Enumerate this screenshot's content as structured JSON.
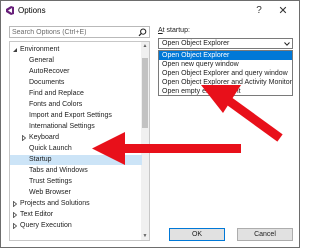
{
  "window": {
    "title": "Options",
    "help_symbol": "?",
    "close_symbol": "✕"
  },
  "search": {
    "placeholder": "Search Options (Ctrl+E)"
  },
  "tree": [
    {
      "label": "Environment",
      "indent": 0,
      "expander": "expanded"
    },
    {
      "label": "General",
      "indent": 1
    },
    {
      "label": "AutoRecover",
      "indent": 1
    },
    {
      "label": "Documents",
      "indent": 1
    },
    {
      "label": "Find and Replace",
      "indent": 1
    },
    {
      "label": "Fonts and Colors",
      "indent": 1
    },
    {
      "label": "Import and Export Settings",
      "indent": 1
    },
    {
      "label": "International Settings",
      "indent": 1
    },
    {
      "label": "Keyboard",
      "indent": 1,
      "expander": "collapsed"
    },
    {
      "label": "Quick Launch",
      "indent": 1
    },
    {
      "label": "Startup",
      "indent": 1,
      "selected": true
    },
    {
      "label": "Tabs and Windows",
      "indent": 1
    },
    {
      "label": "Trust Settings",
      "indent": 1
    },
    {
      "label": "Web Browser",
      "indent": 1
    },
    {
      "label": "Projects and Solutions",
      "indent": 0,
      "expander": "collapsed"
    },
    {
      "label": "Text Editor",
      "indent": 0,
      "expander": "collapsed"
    },
    {
      "label": "Query Execution",
      "indent": 0,
      "expander": "collapsed"
    }
  ],
  "startup": {
    "label_prefix": "A",
    "label_rest": "t startup:",
    "selected": "Open Object Explorer",
    "options": [
      "Open Object Explorer",
      "Open new query window",
      "Open Object Explorer and query window",
      "Open Object Explorer and Activity Monitor",
      "Open empty environment"
    ],
    "highlighted_index": 0
  },
  "buttons": {
    "ok": "OK",
    "cancel": "Cancel"
  },
  "colors": {
    "selection": "#cce4f7",
    "highlight": "#0078d7",
    "annotation_arrow": "#e8101a"
  }
}
